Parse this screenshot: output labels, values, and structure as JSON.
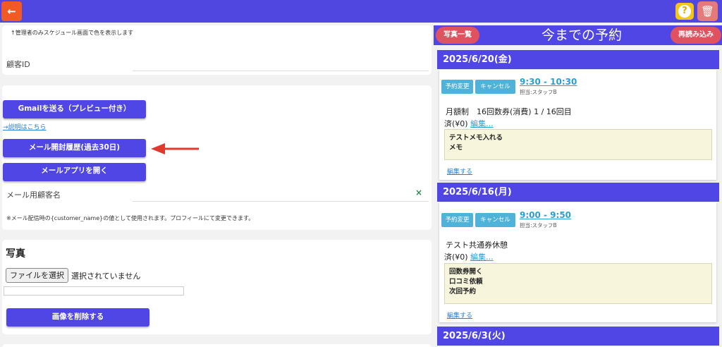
{
  "topbar": {
    "back_icon": "←",
    "help_icon": "?",
    "trash_icon": "🗑"
  },
  "schedule_note": "↑管理者のみスケジュール画面で色を表示します",
  "customer_id_label": "顧客ID",
  "mail": {
    "gmail_button": "Gmailを送る（プレビュー付き）",
    "explain_link": "→説明はこちら",
    "open_history_button": "メール開封履歴(過去30日)",
    "mail_app_button": "メールアプリを開く",
    "mail_name_label": "メール用顧客名",
    "clear_icon": "×",
    "note": "※メール配信時の{customer_name}の値として使用されます。プロフィールにて変更できます。"
  },
  "photo": {
    "heading": "写真",
    "file_button": "ファイルを選択",
    "file_status": "選択されていません",
    "delete_button": "画像を削除する"
  },
  "right_panel": {
    "photo_list_button": "写真一覧",
    "title": "今までの予約",
    "reload_button": "再読み込み",
    "reservations": [
      {
        "date": "2025/6/20(金)",
        "change_button": "予約変更",
        "cancel_button": "キャンセル",
        "time": "9:30 - 10:30",
        "staff": "担当:スタッフB",
        "plan": "月額制　16回数券(消費) 1 / 16回目",
        "paid": "済(¥0)",
        "edit_link": "編集...",
        "memo": [
          "テストメモ入れる",
          "メモ"
        ],
        "edit_memo": "編集する"
      },
      {
        "date": "2025/6/16(月)",
        "change_button": "予約変更",
        "cancel_button": "キャンセル",
        "time": "9:00 - 9:50",
        "staff": "担当:スタッフB",
        "plan": "テスト共通券休憩",
        "paid": "済(¥0)",
        "edit_link": "編集...",
        "memo": [
          "回数券開く",
          "口コミ依頼",
          "次回予約"
        ],
        "edit_memo": "編集する"
      },
      {
        "date": "2025/6/3(火)"
      }
    ]
  },
  "colors": {
    "primary": "#4f46e5",
    "accent": "#f15a24",
    "pill": "#e05260",
    "tag": "#4fb3d9",
    "annotation_arrow": "#e03a2f"
  }
}
